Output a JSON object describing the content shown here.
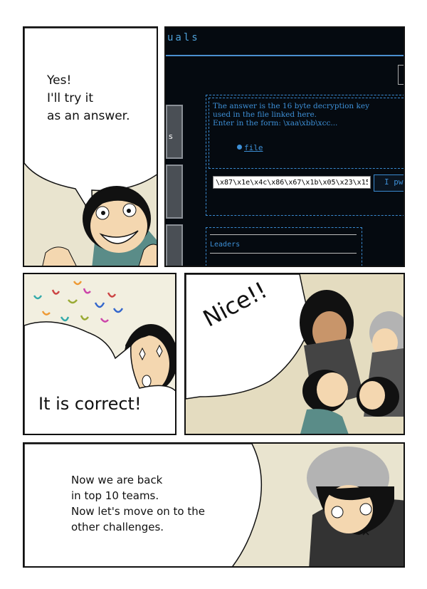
{
  "panel1": {
    "speech_lines": [
      "Yes!",
      "I'll try it",
      "as an answer."
    ]
  },
  "panel2": {
    "header_partial": "uals",
    "side_button_char": "s",
    "challenge_lines": [
      "The answer is the 16 byte decryption key",
      "used in the file linked here.",
      "Enter in the form: \\xaa\\xbb\\xcc..."
    ],
    "file_link": "file",
    "answer_value": "\\x87\\x1e\\x4c\\x86\\x67\\x1b\\x05\\x23\\x15",
    "submit_label_partial": "I pw",
    "leaders_label": "Leaders"
  },
  "panel3": {
    "speech": "It is correct!"
  },
  "panel4": {
    "shout": "Nice!!"
  },
  "panel5": {
    "speech_lines": [
      "Now we are back",
      "in top 10 teams.",
      "Now let's move on to the",
      "other challenges."
    ]
  },
  "colors": {
    "screen_bg": "#050a10",
    "screen_accent": "#3d8fd6",
    "panel_bg": "#e9e4cf"
  }
}
